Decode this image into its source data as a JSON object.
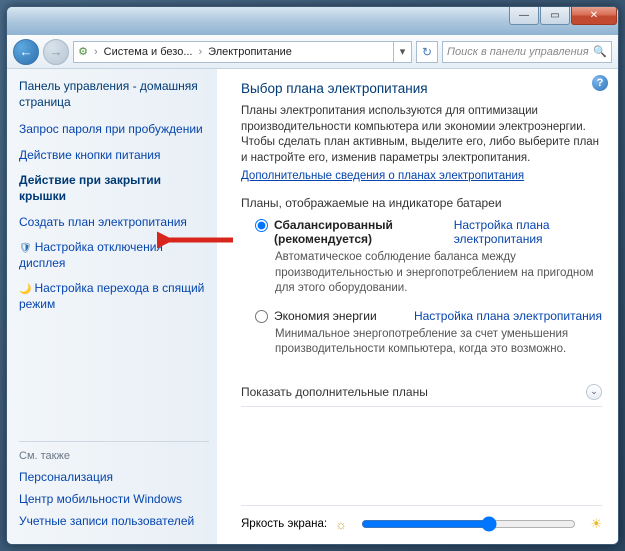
{
  "window": {
    "minimize": "—",
    "maximize": "▭",
    "close": "✕"
  },
  "toolbar": {
    "back": "←",
    "forward": "→",
    "bc_icon": "⚙",
    "bc1": "Система и безо...",
    "bc2": "Электропитание",
    "bc_sep": "›",
    "bc_drop": "▾",
    "refresh": "↻",
    "search_placeholder": "Поиск в панели управления",
    "search_icon": "🔍"
  },
  "sidebar": {
    "home": "Панель управления - домашняя страница",
    "links": [
      "Запрос пароля при пробуждении",
      "Действие кнопки питания",
      "Действие при закрытии крышки",
      "Создать план электропитания",
      "Настройка отключения дисплея",
      "Настройка перехода в спящий режим"
    ],
    "seealso": "См. также",
    "sublinks": [
      "Персонализация",
      "Центр мобильности Windows",
      "Учетные записи пользователей"
    ]
  },
  "main": {
    "help": "?",
    "heading": "Выбор плана электропитания",
    "desc": "Планы электропитания используются для оптимизации производительности компьютера или экономии электроэнергии. Чтобы сделать план активным, выделите его, либо выберите план и настройте его, изменив параметры электропитания.",
    "more_link": "Дополнительные сведения о планах электропитания",
    "plans_hdr": "Планы, отображаемые на индикаторе батареи",
    "plan1": {
      "title": "Сбалансированный (рекомендуется)",
      "config": "Настройка плана электропитания",
      "desc": "Автоматическое соблюдение баланса между производительностью и энергопотреблением на пригодном для этого оборудовании."
    },
    "plan2": {
      "title": "Экономия энергии",
      "config": "Настройка плана электропитания",
      "desc": "Минимальное энергопотребление за счет уменьшения производительности компьютера, когда это возможно."
    },
    "expander": "Показать дополнительные планы",
    "expander_chev": "⌄",
    "brightness_label": "Яркость экрана:",
    "sun_dim": "☼",
    "sun_bright": "☀"
  }
}
